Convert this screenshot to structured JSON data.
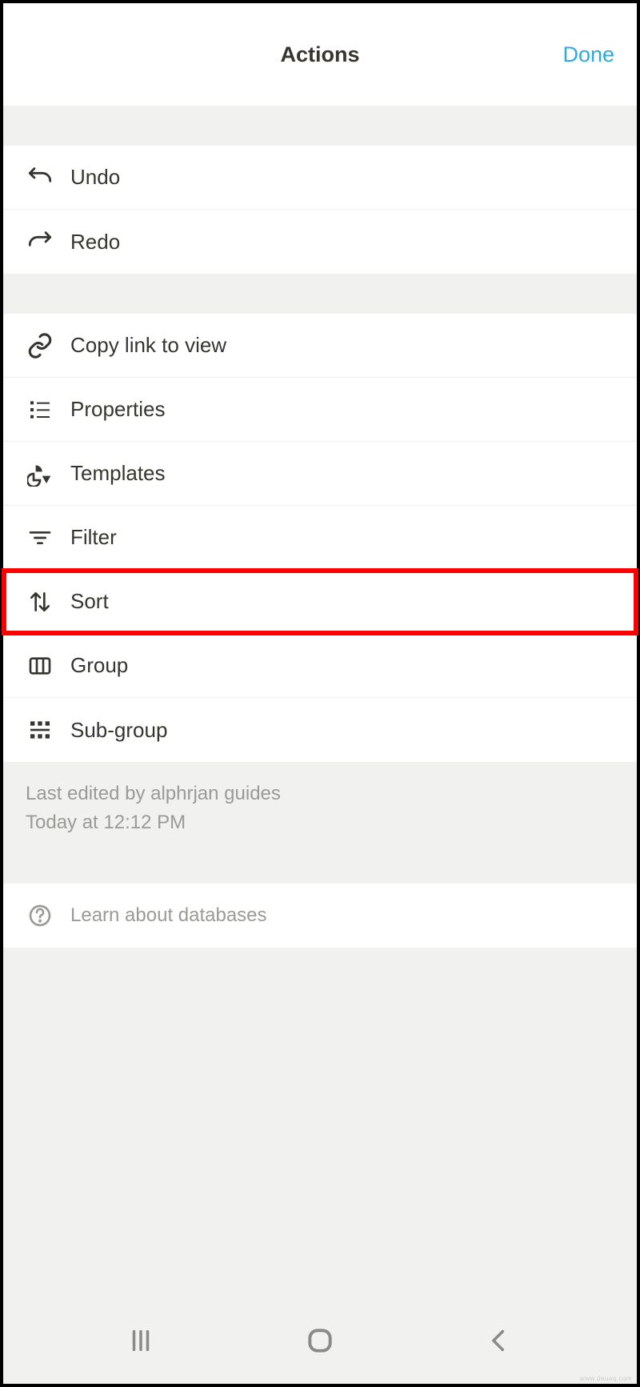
{
  "header": {
    "title": "Actions",
    "done": "Done"
  },
  "sections": {
    "history": {
      "undo": "Undo",
      "redo": "Redo"
    },
    "view": {
      "copyLink": "Copy link to view",
      "properties": "Properties",
      "templates": "Templates",
      "filter": "Filter",
      "sort": "Sort",
      "group": "Group",
      "subGroup": "Sub-group"
    }
  },
  "edited": {
    "line1": "Last edited by alphrjan guides",
    "line2": "Today at 12:12 PM"
  },
  "learn": "Learn about databases",
  "watermark": "www.deuaq.com"
}
